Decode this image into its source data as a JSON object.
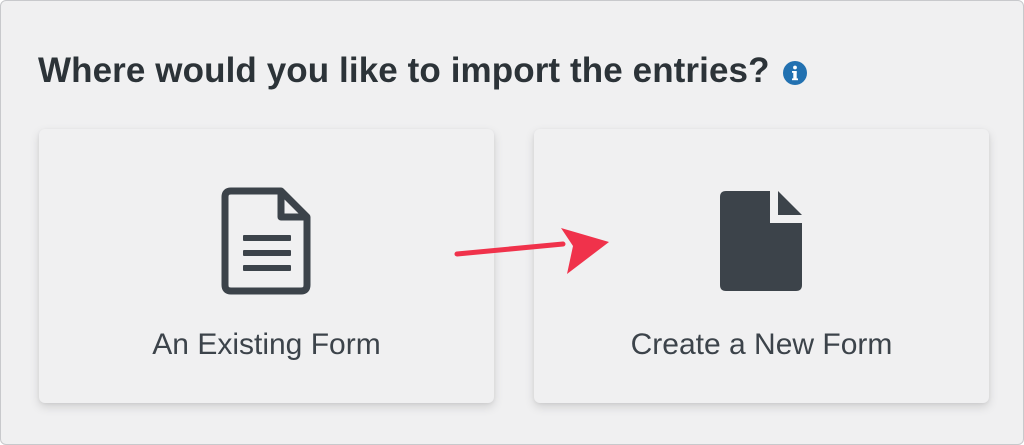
{
  "dialog": {
    "heading": "Where would you like to import the entries?",
    "info_icon": "info-circle-icon"
  },
  "options": [
    {
      "label": "An Existing Form",
      "icon": "document-outline-icon"
    },
    {
      "label": "Create a New Form",
      "icon": "document-filled-icon"
    }
  ],
  "annotation": {
    "icon": "red-arrow-icon",
    "color": "#f0324b"
  },
  "colors": {
    "background": "#f0f0f1",
    "text": "#2c3338",
    "icon": "#3c434a",
    "info": "#2271b1"
  }
}
